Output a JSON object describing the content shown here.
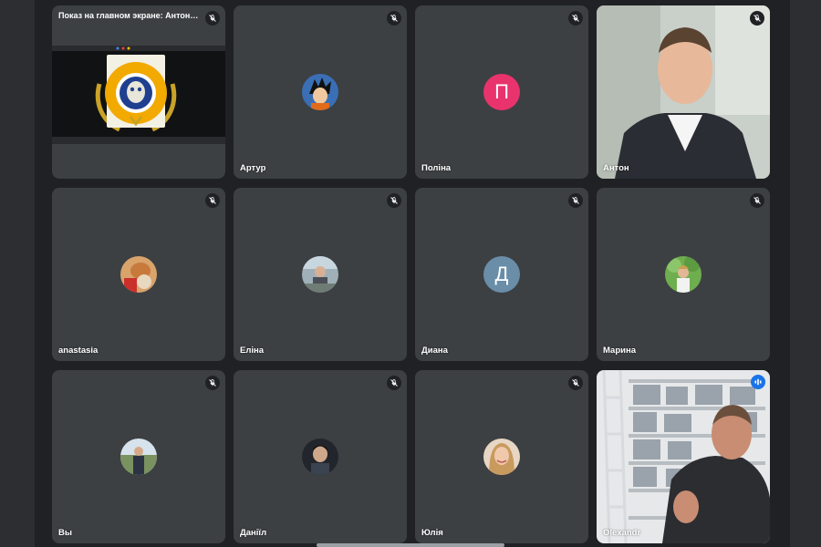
{
  "presentation": {
    "title": "Показ на главном экране: Антон Ба…",
    "muted": true
  },
  "participants": [
    {
      "name": "Артур",
      "muted": true,
      "avatar": "photo-avatar"
    },
    {
      "name": "Поліна",
      "muted": true,
      "avatar_letter": "П",
      "avatar_color": "#e8336d"
    },
    {
      "name": "Антон",
      "muted": true,
      "avatar": "camera-video"
    },
    {
      "name": "anastasia",
      "muted": true,
      "avatar": "photo-avatar"
    },
    {
      "name": "Еліна",
      "muted": true,
      "avatar": "photo-avatar"
    },
    {
      "name": "Диана",
      "muted": true,
      "avatar_letter": "Д",
      "avatar_color": "#6a8da8"
    },
    {
      "name": "Марина",
      "muted": true,
      "avatar": "photo-avatar"
    },
    {
      "name": "Вы",
      "muted": true,
      "avatar": "photo-avatar"
    },
    {
      "name": "Даніїл",
      "muted": true,
      "avatar": "photo-avatar"
    },
    {
      "name": "Юлія",
      "muted": true,
      "avatar": "photo-avatar"
    },
    {
      "name": "Olexandr",
      "muted": false,
      "speaking": true,
      "avatar": "camera-video"
    }
  ],
  "colors": {
    "background": "#202124",
    "tile": "#3c4043",
    "speaking": "#1a73e8"
  }
}
